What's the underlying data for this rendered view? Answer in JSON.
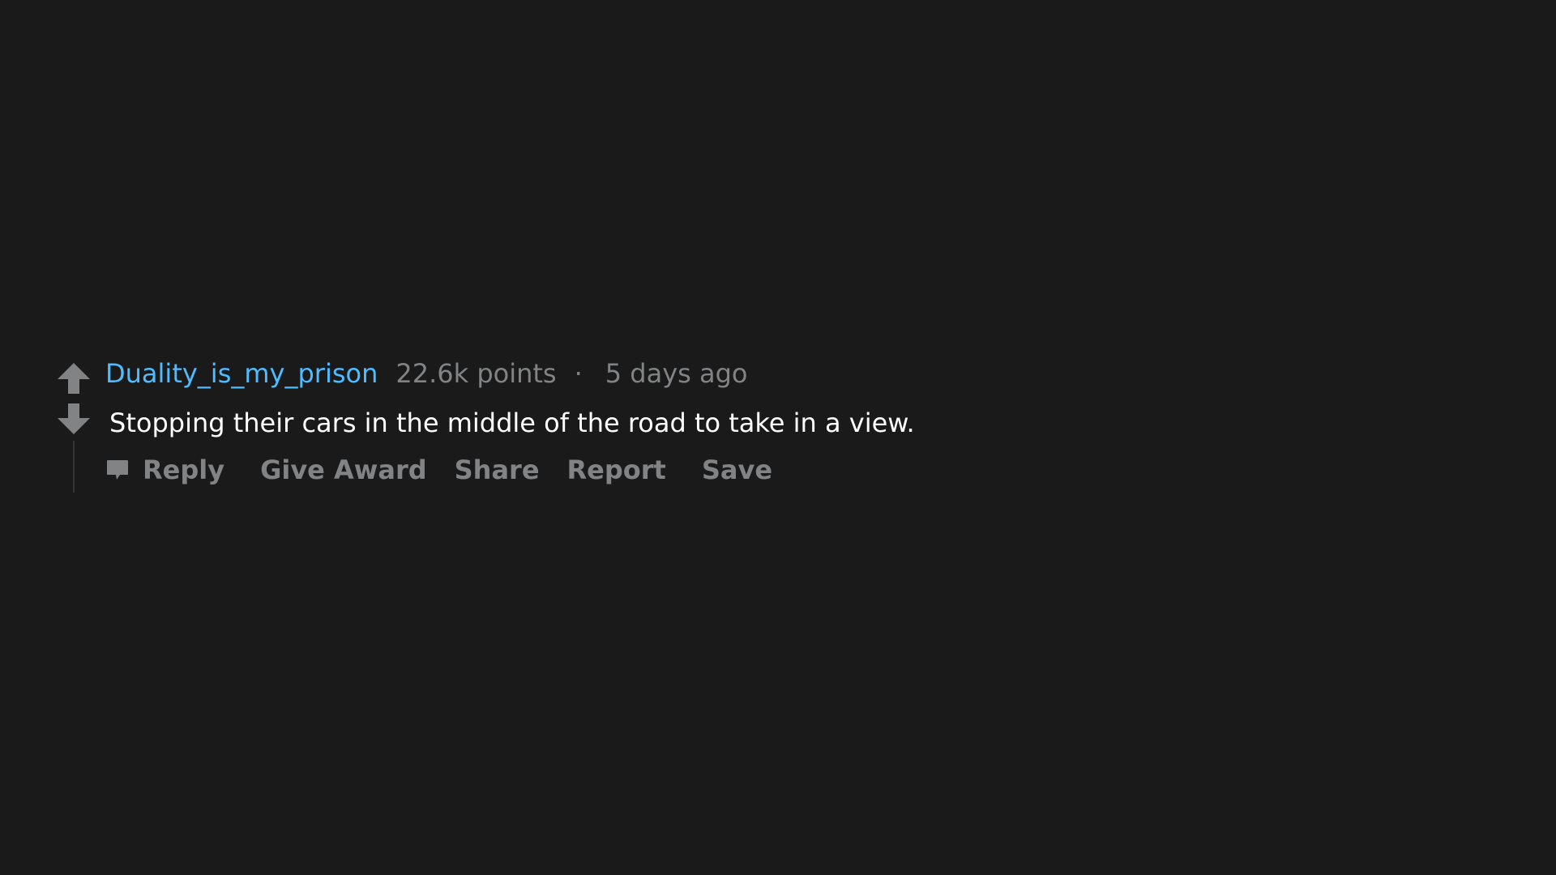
{
  "comment": {
    "author": "Duality_is_my_prison",
    "points": "22.6k points",
    "separator": "·",
    "time": "5 days ago",
    "body": "Stopping their cars in the middle of the road to take in a view.",
    "actions": {
      "reply": "Reply",
      "give_award": "Give Award",
      "share": "Share",
      "report": "Report",
      "save": "Save"
    }
  },
  "icons": {
    "upvote": "arrow-up-icon",
    "downvote": "arrow-down-icon",
    "reply": "comment-bubble-icon"
  },
  "colors": {
    "background": "#1a1a1b",
    "author": "#4fbcff",
    "meta": "#818384",
    "body": "#ffffff",
    "thread_line": "#343536"
  }
}
